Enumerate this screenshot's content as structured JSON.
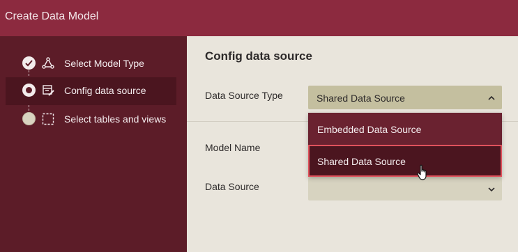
{
  "window": {
    "title": "Create Data Model"
  },
  "steps": [
    {
      "label": "Select Model Type",
      "state": "done",
      "icon": "model-type-icon"
    },
    {
      "label": "Config data source",
      "state": "current",
      "icon": "config-source-icon"
    },
    {
      "label": "Select tables and views",
      "state": "pending",
      "icon": "select-tables-icon"
    }
  ],
  "main": {
    "heading": "Config data source",
    "data_source_type": {
      "label": "Data Source Type",
      "value": "Shared Data Source",
      "expanded": true,
      "options": [
        "Embedded Data Source",
        "Shared Data Source"
      ],
      "highlighted_option": "Shared Data Source"
    },
    "model_name": {
      "label": "Model Name",
      "value": ""
    },
    "data_source": {
      "label": "Data Source",
      "value": ""
    }
  },
  "colors": {
    "titlebar": "#8c2a3f",
    "sidebar": "#5c1c28",
    "active_step": "#4b151f",
    "content_bg": "#e9e5dc",
    "select_bg": "#c4bf9f",
    "highlight_border": "#e0525c"
  }
}
